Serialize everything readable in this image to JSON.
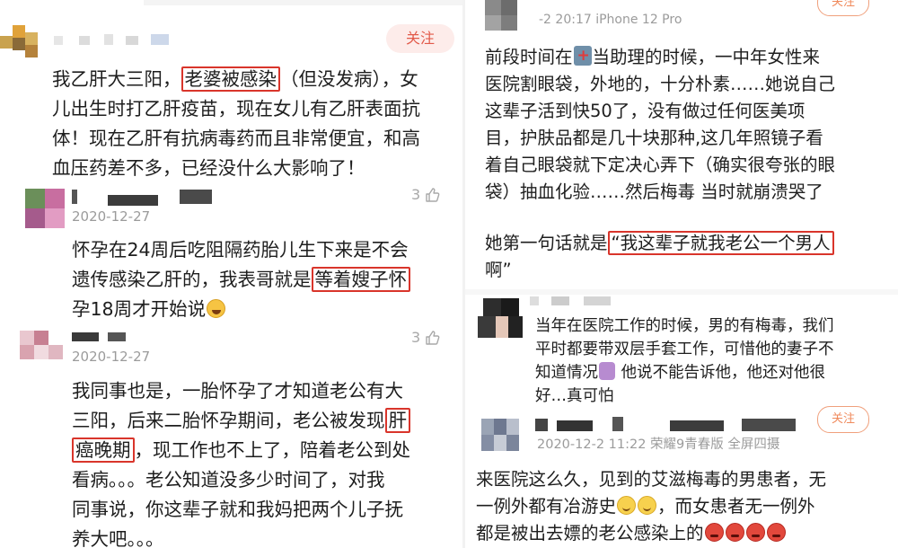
{
  "left": {
    "post": {
      "follow_label": "关注",
      "lines": [
        {
          "segments": [
            {
              "t": "我乙肝大三阳，",
              "hl": false
            },
            {
              "t": "老婆被感染",
              "hl": true
            },
            {
              "t": "（但没发病），女",
              "hl": false
            }
          ]
        },
        {
          "segments": [
            {
              "t": "儿出生时打乙肝疫苗，现在女儿有乙肝表面抗",
              "hl": false
            }
          ]
        },
        {
          "segments": [
            {
              "t": "体！现在乙肝有抗病毒药而且非常便宜，和高",
              "hl": false
            }
          ]
        },
        {
          "segments": [
            {
              "t": "血压药差不多，已经没什么大影响了！",
              "hl": false
            }
          ]
        }
      ]
    },
    "reply1": {
      "date": "2020-12-27",
      "like_count": "3",
      "lines": [
        {
          "segments": [
            {
              "t": "怀孕在24周后吃阻隔药胎儿生下来是不会",
              "hl": false
            }
          ]
        },
        {
          "segments": [
            {
              "t": "遗传感染乙肝的，我表哥就是",
              "hl": false
            },
            {
              "t": "等着嫂子怀",
              "hl": true
            }
          ]
        },
        {
          "segments": [
            {
              "t": "孕18周才开始说",
              "hl": false
            },
            {
              "t": "",
              "emoji": "laugh"
            }
          ]
        }
      ]
    },
    "reply2": {
      "date": "2020-12-27",
      "like_count": "3",
      "lines": [
        {
          "segments": [
            {
              "t": "我同事也是，一胎怀孕了才知道老公有大",
              "hl": false
            }
          ]
        },
        {
          "segments": [
            {
              "t": "三阳，后来二胎怀孕期间，老公被发现",
              "hl": false
            },
            {
              "t": "肝",
              "hl": true
            }
          ]
        },
        {
          "segments": [
            {
              "t": "癌晚期",
              "hl": true
            },
            {
              "t": "，现工作也不上了，陪着老公到处",
              "hl": false
            }
          ]
        },
        {
          "segments": [
            {
              "t": "看病。。。老公知道没多少时间了，对我",
              "hl": false
            }
          ]
        },
        {
          "segments": [
            {
              "t": "同事说，你这辈子就和我妈把两个儿子抚",
              "hl": false
            }
          ]
        },
        {
          "segments": [
            {
              "t": "养大吧。。。",
              "hl": false
            }
          ]
        }
      ]
    }
  },
  "right": {
    "post1": {
      "meta": "-2 20:17  iPhone 12 Pro",
      "follow_label": "关注",
      "lines": [
        {
          "segments": [
            {
              "t": "前段时间在",
              "hl": false
            },
            {
              "t": "",
              "emoji": "hospital"
            },
            {
              "t": "当助理的时候，一中年女性来",
              "hl": false
            }
          ]
        },
        {
          "segments": [
            {
              "t": "医院割眼袋，外地的，十分朴素……她说自己",
              "hl": false
            }
          ]
        },
        {
          "segments": [
            {
              "t": "这辈子活到快50了，没有做过任何医美项",
              "hl": false
            }
          ]
        },
        {
          "segments": [
            {
              "t": "目，护肤品都是几十块那种,这几年照镜子看",
              "hl": false
            }
          ]
        },
        {
          "segments": [
            {
              "t": "着自己眼袋就下定决心弄下（确实很夸张的眼",
              "hl": false
            }
          ]
        },
        {
          "segments": [
            {
              "t": "袋）抽血化验……然后梅毒 当时就崩溃哭了",
              "hl": false
            }
          ]
        }
      ],
      "quote_lines": [
        {
          "segments": [
            {
              "t": "她第一句话就是",
              "hl": false
            },
            {
              "t": "“我这辈子就我老公一个男人",
              "hl": true
            }
          ]
        },
        {
          "segments": [
            {
              "t": "啊”",
              "hl": false
            }
          ]
        }
      ]
    },
    "reply1": {
      "lines": [
        {
          "segments": [
            {
              "t": "当年在医院工作的时候，男的有梅毒，我们",
              "hl": false
            }
          ]
        },
        {
          "segments": [
            {
              "t": "平时都要带双层手套工作，可惜他的妻子不",
              "hl": false
            }
          ]
        },
        {
          "segments": [
            {
              "t": "知道情况",
              "hl": false
            },
            {
              "t": "",
              "emoji": "facepalm"
            },
            {
              "t": " 他说不能告诉他，他还对他很",
              "hl": false
            }
          ]
        },
        {
          "segments": [
            {
              "t": "好…真可怕",
              "hl": false
            }
          ]
        }
      ]
    },
    "post2": {
      "meta": "2020-12-2 11:22  荣耀9青春版 全屏四摄",
      "follow_label": "关注",
      "lines": [
        {
          "segments": [
            {
              "t": "来医院这么久，见到的艾滋梅毒的男患者，无",
              "hl": false
            }
          ]
        },
        {
          "segments": [
            {
              "t": "一例外都有冶游史",
              "hl": false
            },
            {
              "t": "",
              "emoji": "smile"
            },
            {
              "t": "",
              "emoji": "smile"
            },
            {
              "t": "，而女患者无一例外",
              "hl": false
            }
          ]
        },
        {
          "segments": [
            {
              "t": "都是被出去嫖的老公感染上的",
              "hl": false
            },
            {
              "t": "",
              "emoji": "angry"
            },
            {
              "t": "",
              "emoji": "angry"
            },
            {
              "t": "",
              "emoji": "angry"
            },
            {
              "t": "",
              "emoji": "angry"
            }
          ]
        }
      ]
    }
  },
  "colors": {
    "highlight_border": "#d9352b",
    "follow_bg": "#fdecea",
    "follow_text": "#e25a4a",
    "meta_text": "#9b9b9b"
  }
}
